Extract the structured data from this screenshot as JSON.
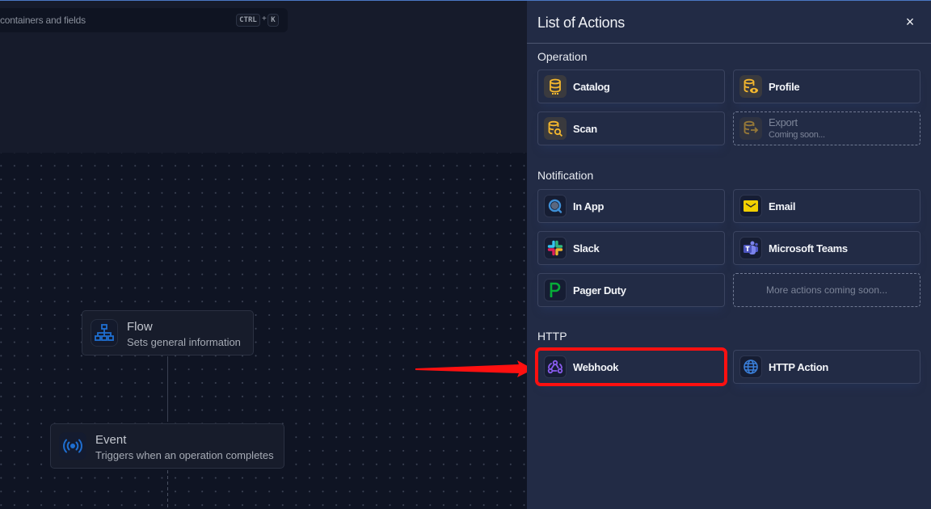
{
  "search": {
    "placeholder_text": "containers and fields",
    "shortcut_key1": "CTRL",
    "shortcut_plus": "+",
    "shortcut_key2": "K"
  },
  "flow_nodes": [
    {
      "title": "Flow",
      "subtitle": "Sets general information",
      "icon": "sitemap-icon"
    },
    {
      "title": "Event",
      "subtitle": "Triggers when an operation completes",
      "icon": "broadcast-icon"
    }
  ],
  "panel": {
    "title": "List of Actions",
    "close_label": "×",
    "sections": [
      {
        "label": "Operation",
        "items": [
          {
            "label": "Catalog",
            "icon": "database-icon",
            "enabled": true
          },
          {
            "label": "Profile",
            "icon": "database-eye-icon",
            "enabled": true
          },
          {
            "label": "Scan",
            "icon": "database-search-icon",
            "enabled": true
          },
          {
            "label": "Export",
            "sublabel": "Coming soon...",
            "icon": "database-export-icon",
            "enabled": false
          }
        ]
      },
      {
        "label": "Notification",
        "items": [
          {
            "label": "In App",
            "icon": "in-app-icon",
            "enabled": true
          },
          {
            "label": "Email",
            "icon": "email-icon",
            "enabled": true
          },
          {
            "label": "Slack",
            "icon": "slack-icon",
            "enabled": true
          },
          {
            "label": "Microsoft Teams",
            "icon": "microsoft-teams-icon",
            "enabled": true
          },
          {
            "label": "Pager Duty",
            "icon": "pagerduty-icon",
            "enabled": true
          },
          {
            "label": "More actions coming soon...",
            "enabled": false
          }
        ]
      },
      {
        "label": "HTTP",
        "items": [
          {
            "label": "Webhook",
            "icon": "webhook-icon",
            "enabled": true,
            "highlighted": true
          },
          {
            "label": "HTTP Action",
            "icon": "globe-icon",
            "enabled": true
          }
        ]
      }
    ]
  },
  "annotation": {
    "type": "red-arrow",
    "target": "Webhook",
    "color": "#ff1010"
  },
  "colors": {
    "accent_operation": "#f5b82e",
    "highlight": "#ff1010",
    "panel_bg": "#222b45"
  }
}
